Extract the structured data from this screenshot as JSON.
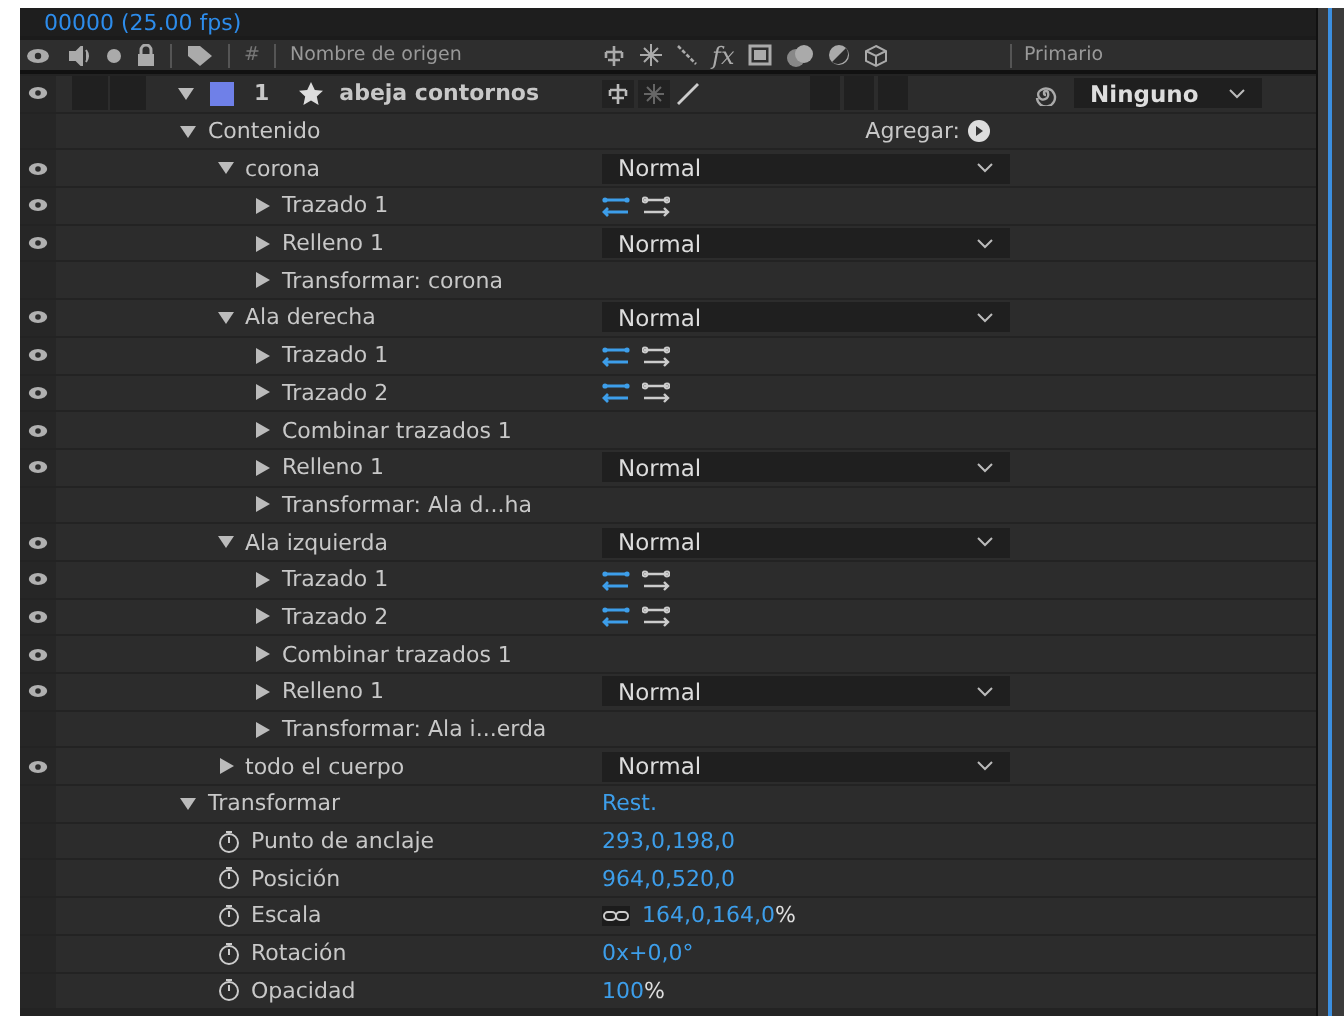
{
  "top_bar": {
    "timecode": "00000 (25.00 fps)"
  },
  "header": {
    "number_label": "#",
    "name_label": "Nombre de origen",
    "effects_label": "fx",
    "parent_label": "Primario"
  },
  "layer": {
    "eye": true,
    "expanded": true,
    "color": "#6f80e8",
    "number": "1",
    "name": "abeja contornos",
    "parent": "Ninguno",
    "children": [
      {
        "label": "Contenido",
        "eye": false,
        "expanded": true,
        "add_label": "Agregar:",
        "children": [
          {
            "label": "corona",
            "eye": true,
            "expanded": true,
            "mode": "Normal",
            "children": [
              {
                "label": "Trazado 1",
                "eye": true,
                "expanded": false,
                "path_icons": true
              },
              {
                "label": "Relleno 1",
                "eye": true,
                "expanded": false,
                "mode": "Normal"
              },
              {
                "label": "Transformar: corona",
                "eye": false,
                "expanded": false
              }
            ]
          },
          {
            "label": "Ala derecha",
            "eye": true,
            "expanded": true,
            "mode": "Normal",
            "children": [
              {
                "label": "Trazado 1",
                "eye": true,
                "expanded": false,
                "path_icons": true
              },
              {
                "label": "Trazado 2",
                "eye": true,
                "expanded": false,
                "path_icons": true
              },
              {
                "label": "Combinar trazados 1",
                "eye": true,
                "expanded": false
              },
              {
                "label": "Relleno 1",
                "eye": true,
                "expanded": false,
                "mode": "Normal"
              },
              {
                "label": "Transformar: Ala d...ha",
                "eye": false,
                "expanded": false
              }
            ]
          },
          {
            "label": "Ala izquierda",
            "eye": true,
            "expanded": true,
            "mode": "Normal",
            "children": [
              {
                "label": "Trazado 1",
                "eye": true,
                "expanded": false,
                "path_icons": true
              },
              {
                "label": "Trazado 2",
                "eye": true,
                "expanded": false,
                "path_icons": true
              },
              {
                "label": "Combinar trazados 1",
                "eye": true,
                "expanded": false
              },
              {
                "label": "Relleno 1",
                "eye": true,
                "expanded": false,
                "mode": "Normal"
              },
              {
                "label": "Transformar: Ala i...erda",
                "eye": false,
                "expanded": false
              }
            ]
          },
          {
            "label": "todo el cuerpo",
            "eye": true,
            "expanded": false,
            "mode": "Normal"
          }
        ]
      },
      {
        "label": "Transformar",
        "eye": false,
        "expanded": true,
        "reset": "Rest.",
        "children": [
          {
            "kind": "property",
            "label": "Punto de anclaje",
            "eye": false,
            "value": "293,0,198,0"
          },
          {
            "kind": "property",
            "label": "Posición",
            "eye": false,
            "value": "964,0,520,0"
          },
          {
            "kind": "property",
            "label": "Escala",
            "eye": false,
            "linked": true,
            "value": "164,0,164,0",
            "unit": "%"
          },
          {
            "kind": "property",
            "label": "Rotación",
            "eye": false,
            "value": "0x+0,0°"
          },
          {
            "kind": "property",
            "label": "Opacidad",
            "eye": false,
            "value": "100",
            "unit": "%"
          }
        ]
      }
    ]
  }
}
